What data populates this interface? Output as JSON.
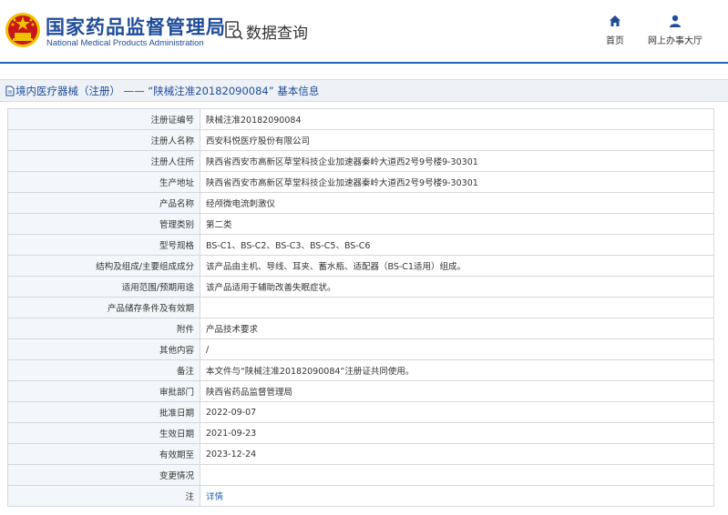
{
  "header": {
    "org_name_cn": "国家药品监督管理局",
    "org_name_en": "National Medical Products Administration",
    "page_title": "数据查询",
    "nav": [
      {
        "label": "首页",
        "icon": "home-icon"
      },
      {
        "label": "网上办事大厅",
        "icon": "user-icon"
      }
    ]
  },
  "colors": {
    "brand": "#1f4c9a",
    "link": "#1f65b5",
    "emblem_red": "#c8161d",
    "emblem_gold": "#f2c200"
  },
  "section_title": "境内医疗器械（注册） —— “陕械注准20182090084” 基本信息",
  "rows": [
    {
      "label": "注册证编号",
      "value": "陕械注准20182090084"
    },
    {
      "label": "注册人名称",
      "value": "西安科悦医疗股份有限公司"
    },
    {
      "label": "注册人住所",
      "value": "陕西省西安市高新区草堂科技企业加速器秦岭大道西2号9号楼9-30301"
    },
    {
      "label": "生产地址",
      "value": "陕西省西安市高新区草堂科技企业加速器秦岭大道西2号9号楼9-30301"
    },
    {
      "label": "产品名称",
      "value": "经颅微电流刺激仪"
    },
    {
      "label": "管理类别",
      "value": "第二类"
    },
    {
      "label": "型号规格",
      "value": "BS-C1、BS-C2、BS-C3、BS-C5、BS-C6"
    },
    {
      "label": "结构及组成/主要组成成分",
      "value": "该产品由主机、导线、耳夹、蓄水瓶、适配器（BS-C1适用）组成。"
    },
    {
      "label": "适用范围/预期用途",
      "value": "该产品适用于辅助改善失眠症状。"
    },
    {
      "label": "产品储存条件及有效期",
      "value": ""
    },
    {
      "label": "附件",
      "value": "产品技术要求"
    },
    {
      "label": "其他内容",
      "value": "/"
    },
    {
      "label": "备注",
      "value": "本文件与“陕械注准20182090084”注册证共同使用。"
    },
    {
      "label": "审批部门",
      "value": "陕西省药品监督管理局"
    },
    {
      "label": "批准日期",
      "value": "2022-09-07"
    },
    {
      "label": "生效日期",
      "value": "2021-09-23"
    },
    {
      "label": "有效期至",
      "value": "2023-12-24"
    },
    {
      "label": "变更情况",
      "value": ""
    },
    {
      "label": "注",
      "value": "详情",
      "link": true
    }
  ]
}
